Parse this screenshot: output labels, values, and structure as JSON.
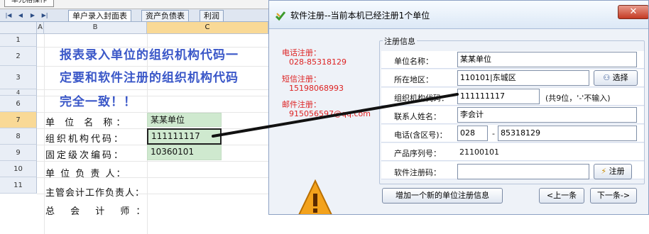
{
  "sheet": {
    "top_button": "单元格操作",
    "nav_icons": [
      "first-sheet-icon",
      "prev-sheet-icon",
      "next-sheet-icon",
      "last-sheet-icon"
    ],
    "tabs": [
      "单户录入封面表",
      "资产负债表",
      "利润"
    ],
    "columns": [
      "A",
      "B",
      "C"
    ],
    "rows": [
      "1",
      "2",
      "3",
      "4",
      "6",
      "7",
      "8",
      "9",
      "10",
      "11"
    ],
    "note_lines": [
      "报表录入单位的组织机构代码一",
      "定要和软件注册的组织机构代码",
      "完全一致！！"
    ],
    "labels": [
      "单 位 名 称：",
      "组织机构代码：",
      "固定级次编码：",
      "单 位 负 责 人：",
      "主管会计工作负责人：",
      "总 会 计 师："
    ],
    "values": [
      "某某单位",
      "111111117",
      "10360101"
    ]
  },
  "dialog": {
    "title": "软件注册--当前本机已经注册1个单位",
    "close_label": "✕",
    "contacts": [
      {
        "label": "电话注册：",
        "value": "028-85318129"
      },
      {
        "label": "短信注册：",
        "value": "15198068993"
      },
      {
        "label": "邮件注册：",
        "value": "915056597@qq.com"
      }
    ],
    "group_title": "注册信息",
    "fields": {
      "unit_name_label": "单位名称：",
      "unit_name": "某某单位",
      "region_label": "所在地区：",
      "region": "110101|东城区",
      "select_button": "选择",
      "org_code_label": "组织机构代码：",
      "org_code": "111111117",
      "org_code_hint": "(共9位，'-'不输入)",
      "contact_label": "联系人姓名：",
      "contact": "李会计",
      "phone_label": "电话(含区号)：",
      "area_code": "028",
      "phone_dash": "-",
      "phone": "85318129",
      "serial_label": "产品序列号：",
      "serial": "21100101",
      "reg_code_label": "软件注册码：",
      "reg_code": "",
      "register_button": "注册"
    },
    "add_button": "增加一个新的单位注册信息",
    "prev_button": "<上一条",
    "next_button": "下一条->"
  },
  "colors": {
    "note": "#3a57c8",
    "contact": "#dd2222",
    "cell_fill": "#cfe9cf",
    "selected_header": "#f9d996"
  }
}
